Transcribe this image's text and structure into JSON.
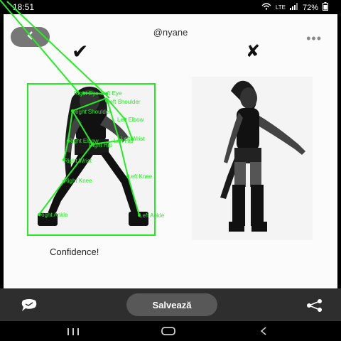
{
  "status_bar": {
    "time": "18:51",
    "network_label": "LTE",
    "battery": "72%"
  },
  "header": {
    "username": "@nyane"
  },
  "comparison": {
    "left_mark": "✔",
    "right_mark": "✘",
    "caption": "Confidence!"
  },
  "pose_labels": [
    "Right Eye",
    "Left Eye",
    "Left Shoulder",
    "Right Shoulder",
    "Left Elbow",
    "Left Wrist",
    "Right Elbow",
    "Left Hip",
    "Right Hip",
    "Right Wrist",
    "Right Knee",
    "Left Knee",
    "Right Ankle",
    "Left Ankle"
  ],
  "bottom_bar": {
    "save_label": "Salvează"
  },
  "colors": {
    "pose_overlay": "#22ee22",
    "save_button": "#585858"
  }
}
